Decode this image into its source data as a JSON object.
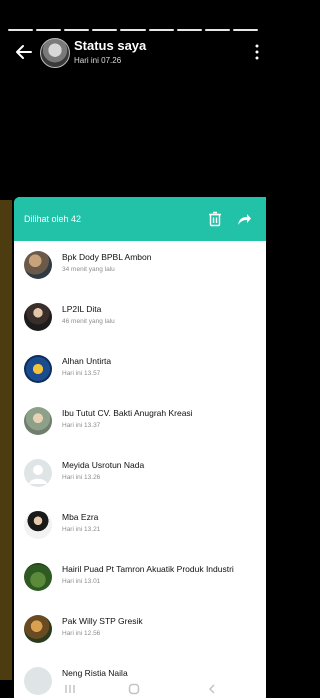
{
  "header": {
    "title": "Status saya",
    "subtitle": "Hari ini 07.26"
  },
  "sheet": {
    "viewed_label": "Dilihat oleh 42",
    "viewers": [
      {
        "name": "Bpk Dody BPBL Ambon",
        "time": "34 menit yang lalu"
      },
      {
        "name": "LP2IL Dita",
        "time": "46 menit yang lalu"
      },
      {
        "name": "Alhan Untirta",
        "time": "Hari ini 13.57"
      },
      {
        "name": "Ibu Tutut CV. Bakti Anugrah Kreasi",
        "time": "Hari ini 13.37"
      },
      {
        "name": "Meyida Usrotun Nada",
        "time": "Hari ini 13.26"
      },
      {
        "name": "Mba Ezra",
        "time": "Hari ini 13.21"
      },
      {
        "name": "Hairil Puad Pt Tamron Akuatik Produk Industri",
        "time": "Hari ini 13.01"
      },
      {
        "name": "Pak Willy STP Gresik",
        "time": "Hari ini 12.56"
      },
      {
        "name": "Neng Ristia Naila",
        "time": ""
      }
    ]
  },
  "icons": {
    "back": "arrow-left-icon",
    "menu": "more-vertical-icon",
    "delete": "trash-icon",
    "forward": "share-forward-icon"
  },
  "colors": {
    "accent": "#21c2a8",
    "background": "#000000"
  }
}
